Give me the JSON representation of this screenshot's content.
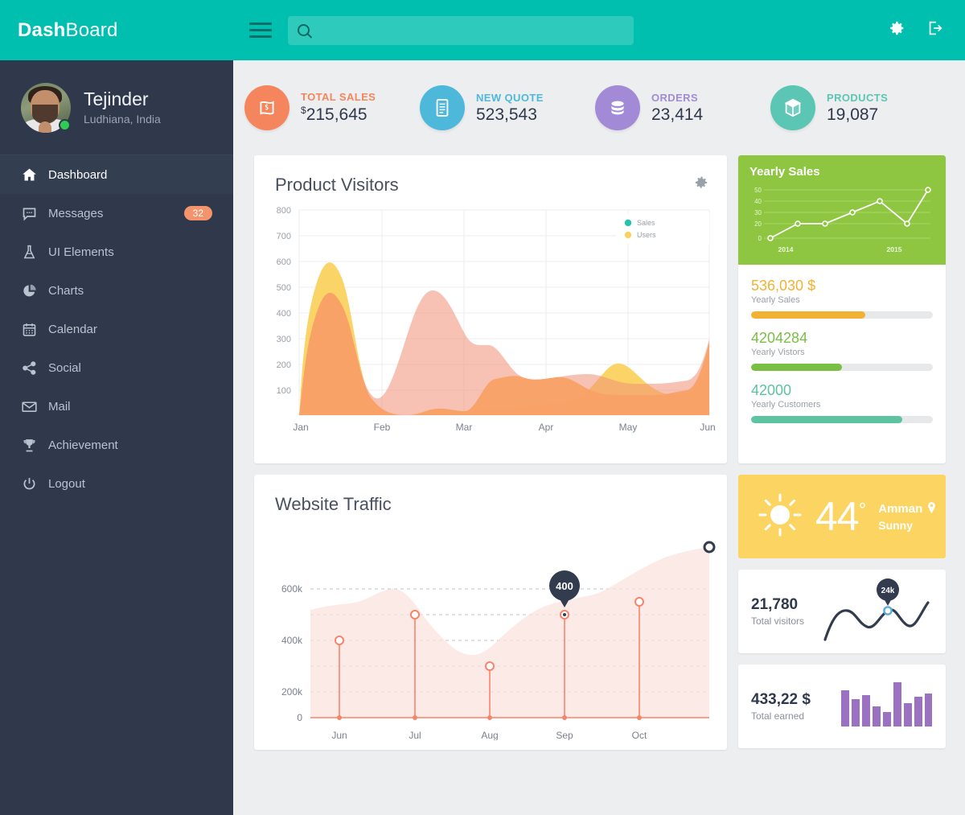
{
  "header": {
    "brand_bold": "Dash",
    "brand_light": "Board",
    "search_placeholder": "",
    "search_value": "",
    "menu_icon": "hamburger-icon",
    "settings_icon": "gear-icon",
    "logout_icon": "sign-out-icon",
    "bg_color": "#00bfae"
  },
  "sidebar": {
    "profile": {
      "name": "Tejinder",
      "location": "Ludhiana,  India",
      "status": "online"
    },
    "items": [
      {
        "label": "Dashboard",
        "icon": "home-icon",
        "active": true,
        "badge": ""
      },
      {
        "label": "Messages",
        "icon": "chat-icon",
        "active": false,
        "badge": "32"
      },
      {
        "label": "UI Elements",
        "icon": "flask-icon",
        "active": false,
        "badge": ""
      },
      {
        "label": "Charts",
        "icon": "pie-chart-icon",
        "active": false,
        "badge": ""
      },
      {
        "label": "Calendar",
        "icon": "calendar-icon",
        "active": false,
        "badge": ""
      },
      {
        "label": "Social",
        "icon": "share-icon",
        "active": false,
        "badge": ""
      },
      {
        "label": "Mail",
        "icon": "envelope-icon",
        "active": false,
        "badge": ""
      },
      {
        "label": "Achievement",
        "icon": "trophy-icon",
        "active": false,
        "badge": ""
      },
      {
        "label": "Logout",
        "icon": "power-icon",
        "active": false,
        "badge": ""
      }
    ],
    "badge_color": "#f5936c",
    "bg_color": "#2f394b"
  },
  "stats": [
    {
      "label": "TOTAL SALES",
      "value": "215,645",
      "currency": "$",
      "icon": "money-note-icon",
      "color": "#f5855c"
    },
    {
      "label": "NEW QUOTE",
      "value": "523,543",
      "currency": "",
      "icon": "document-icon",
      "color": "#4eb8db"
    },
    {
      "label": "ORDERS",
      "value": "23,414",
      "currency": "",
      "icon": "database-icon",
      "color": "#a28ad6"
    },
    {
      "label": "PRODUCTS",
      "value": "19,087",
      "currency": "",
      "icon": "cube-icon",
      "color": "#5bc6b4"
    }
  ],
  "product_visitors": {
    "title": "Product Visitors",
    "gear_icon": "gear-icon"
  },
  "website_traffic": {
    "title": "Website Traffic",
    "tooltip": "400"
  },
  "yearly_sales_card": {
    "title": "Yearly Sales",
    "bg_color": "#8ec641"
  },
  "metrics": [
    {
      "value": "536,030 $",
      "label": "Yearly Sales",
      "percent": 63,
      "color": "#f3b133"
    },
    {
      "value": "4204284",
      "label": "Yearly Vistors",
      "percent": 50,
      "color": "#79bf43"
    },
    {
      "value": "42000",
      "label": "Yearly Customers",
      "percent": 83,
      "color": "#5dc3a0"
    }
  ],
  "weather": {
    "temperature": "44",
    "degree_symbol": "°",
    "city": "Amman",
    "condition": "Sunny",
    "icon": "sun-icon",
    "pin_icon": "location-pin-icon",
    "bg_color": "#fcd462"
  },
  "total_visitors": {
    "value": "21,780",
    "label": "Total visitors",
    "tooltip": "24k"
  },
  "total_earned": {
    "value": "433,22 $",
    "label": "Total earned",
    "bar_color": "#9b72c2"
  },
  "chart_data": [
    {
      "type": "area",
      "title": "Product Visitors",
      "xlabel": "",
      "ylabel": "",
      "x": [
        "Jan",
        "Feb",
        "Mar",
        "Apr",
        "May",
        "Jun"
      ],
      "tick_labels_y": [
        100,
        200,
        300,
        400,
        500,
        600,
        700,
        800
      ],
      "ylim": [
        0,
        800
      ],
      "grid": true,
      "legend": [
        "Sales",
        "Users"
      ],
      "legend_position": "top-right",
      "series": [
        {
          "name": "Users",
          "color": "#fbd25f",
          "values": [
            10,
            550,
            85,
            540,
            305,
            140,
            100,
            110,
            260,
            160,
            325
          ]
        },
        {
          "name": "Sales",
          "color": "#f4a07a",
          "values": [
            10,
            450,
            160,
            540,
            315,
            140,
            150,
            140,
            115,
            160,
            310
          ]
        }
      ],
      "note": "Two smoothed overlapping area series sampled across Jan-Jun"
    },
    {
      "type": "line",
      "title": "Yearly Sales",
      "x": [
        "2014",
        "",
        "",
        "",
        "",
        "2015",
        ""
      ],
      "values": [
        0,
        20,
        20,
        30,
        40,
        20,
        50
      ],
      "tick_labels_y": [
        0,
        20,
        30,
        40,
        50
      ],
      "ylim": [
        0,
        55
      ],
      "grid": true,
      "color": "#ffffff",
      "xlabel": "",
      "ylabel": ""
    },
    {
      "type": "area",
      "title": "Website Traffic",
      "x": [
        "Jun",
        "Jul",
        "Aug",
        "Sep",
        "Oct"
      ],
      "values": [
        300000,
        400000,
        200000,
        400000,
        500000
      ],
      "endpoint_value": 650000,
      "tick_labels_y": [
        "0",
        "200k",
        "400k",
        "600k"
      ],
      "ylim": [
        0,
        700000
      ],
      "grid": true,
      "color": "#f8836b",
      "annotation": "400",
      "annotation_at": "Sep",
      "xlabel": "",
      "ylabel": ""
    },
    {
      "type": "line",
      "title": "Total visitors sparkline",
      "values": [
        5,
        30,
        55,
        42,
        30,
        52,
        78,
        55,
        38,
        58,
        82
      ],
      "annotation": "24k",
      "color": "#323c4e",
      "xlabel": "",
      "ylabel": ""
    },
    {
      "type": "bar",
      "title": "Total earned sparkline",
      "categories": [
        "1",
        "2",
        "3",
        "4",
        "5",
        "6",
        "7",
        "8",
        "9"
      ],
      "values": [
        82,
        62,
        72,
        45,
        33,
        100,
        52,
        68,
        75
      ],
      "color": "#9b72c2",
      "xlabel": "",
      "ylabel": ""
    }
  ]
}
